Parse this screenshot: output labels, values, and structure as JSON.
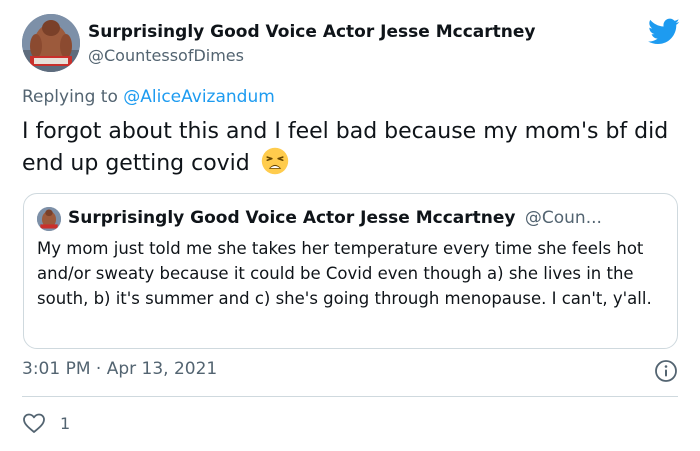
{
  "author": {
    "display_name": "Surprisingly Good Voice Actor Jesse Mccartney",
    "handle": "@CountessofDimes"
  },
  "reply": {
    "prefix": "Replying to",
    "mention": "@AliceAvizandum"
  },
  "tweet": {
    "text": "I forgot about this and I feel bad because my mom's bf did end up getting covid",
    "emoji": "weary-face"
  },
  "quoted": {
    "display_name": "Surprisingly Good Voice Actor Jesse Mccartney",
    "handle": "@Coun...",
    "text": "My mom just told me she takes her temperature every time she feels hot and/or sweaty because it could be Covid even though a) she lives in the south, b) it's summer and c) she's going through menopause. I can't, y'all."
  },
  "meta": {
    "timestamp": "3:01 PM · Apr 13, 2021"
  },
  "actions": {
    "like_count": "1"
  },
  "colors": {
    "brand": "#1d9bf0",
    "secondary_text": "#536471",
    "border": "#cfd9de"
  }
}
